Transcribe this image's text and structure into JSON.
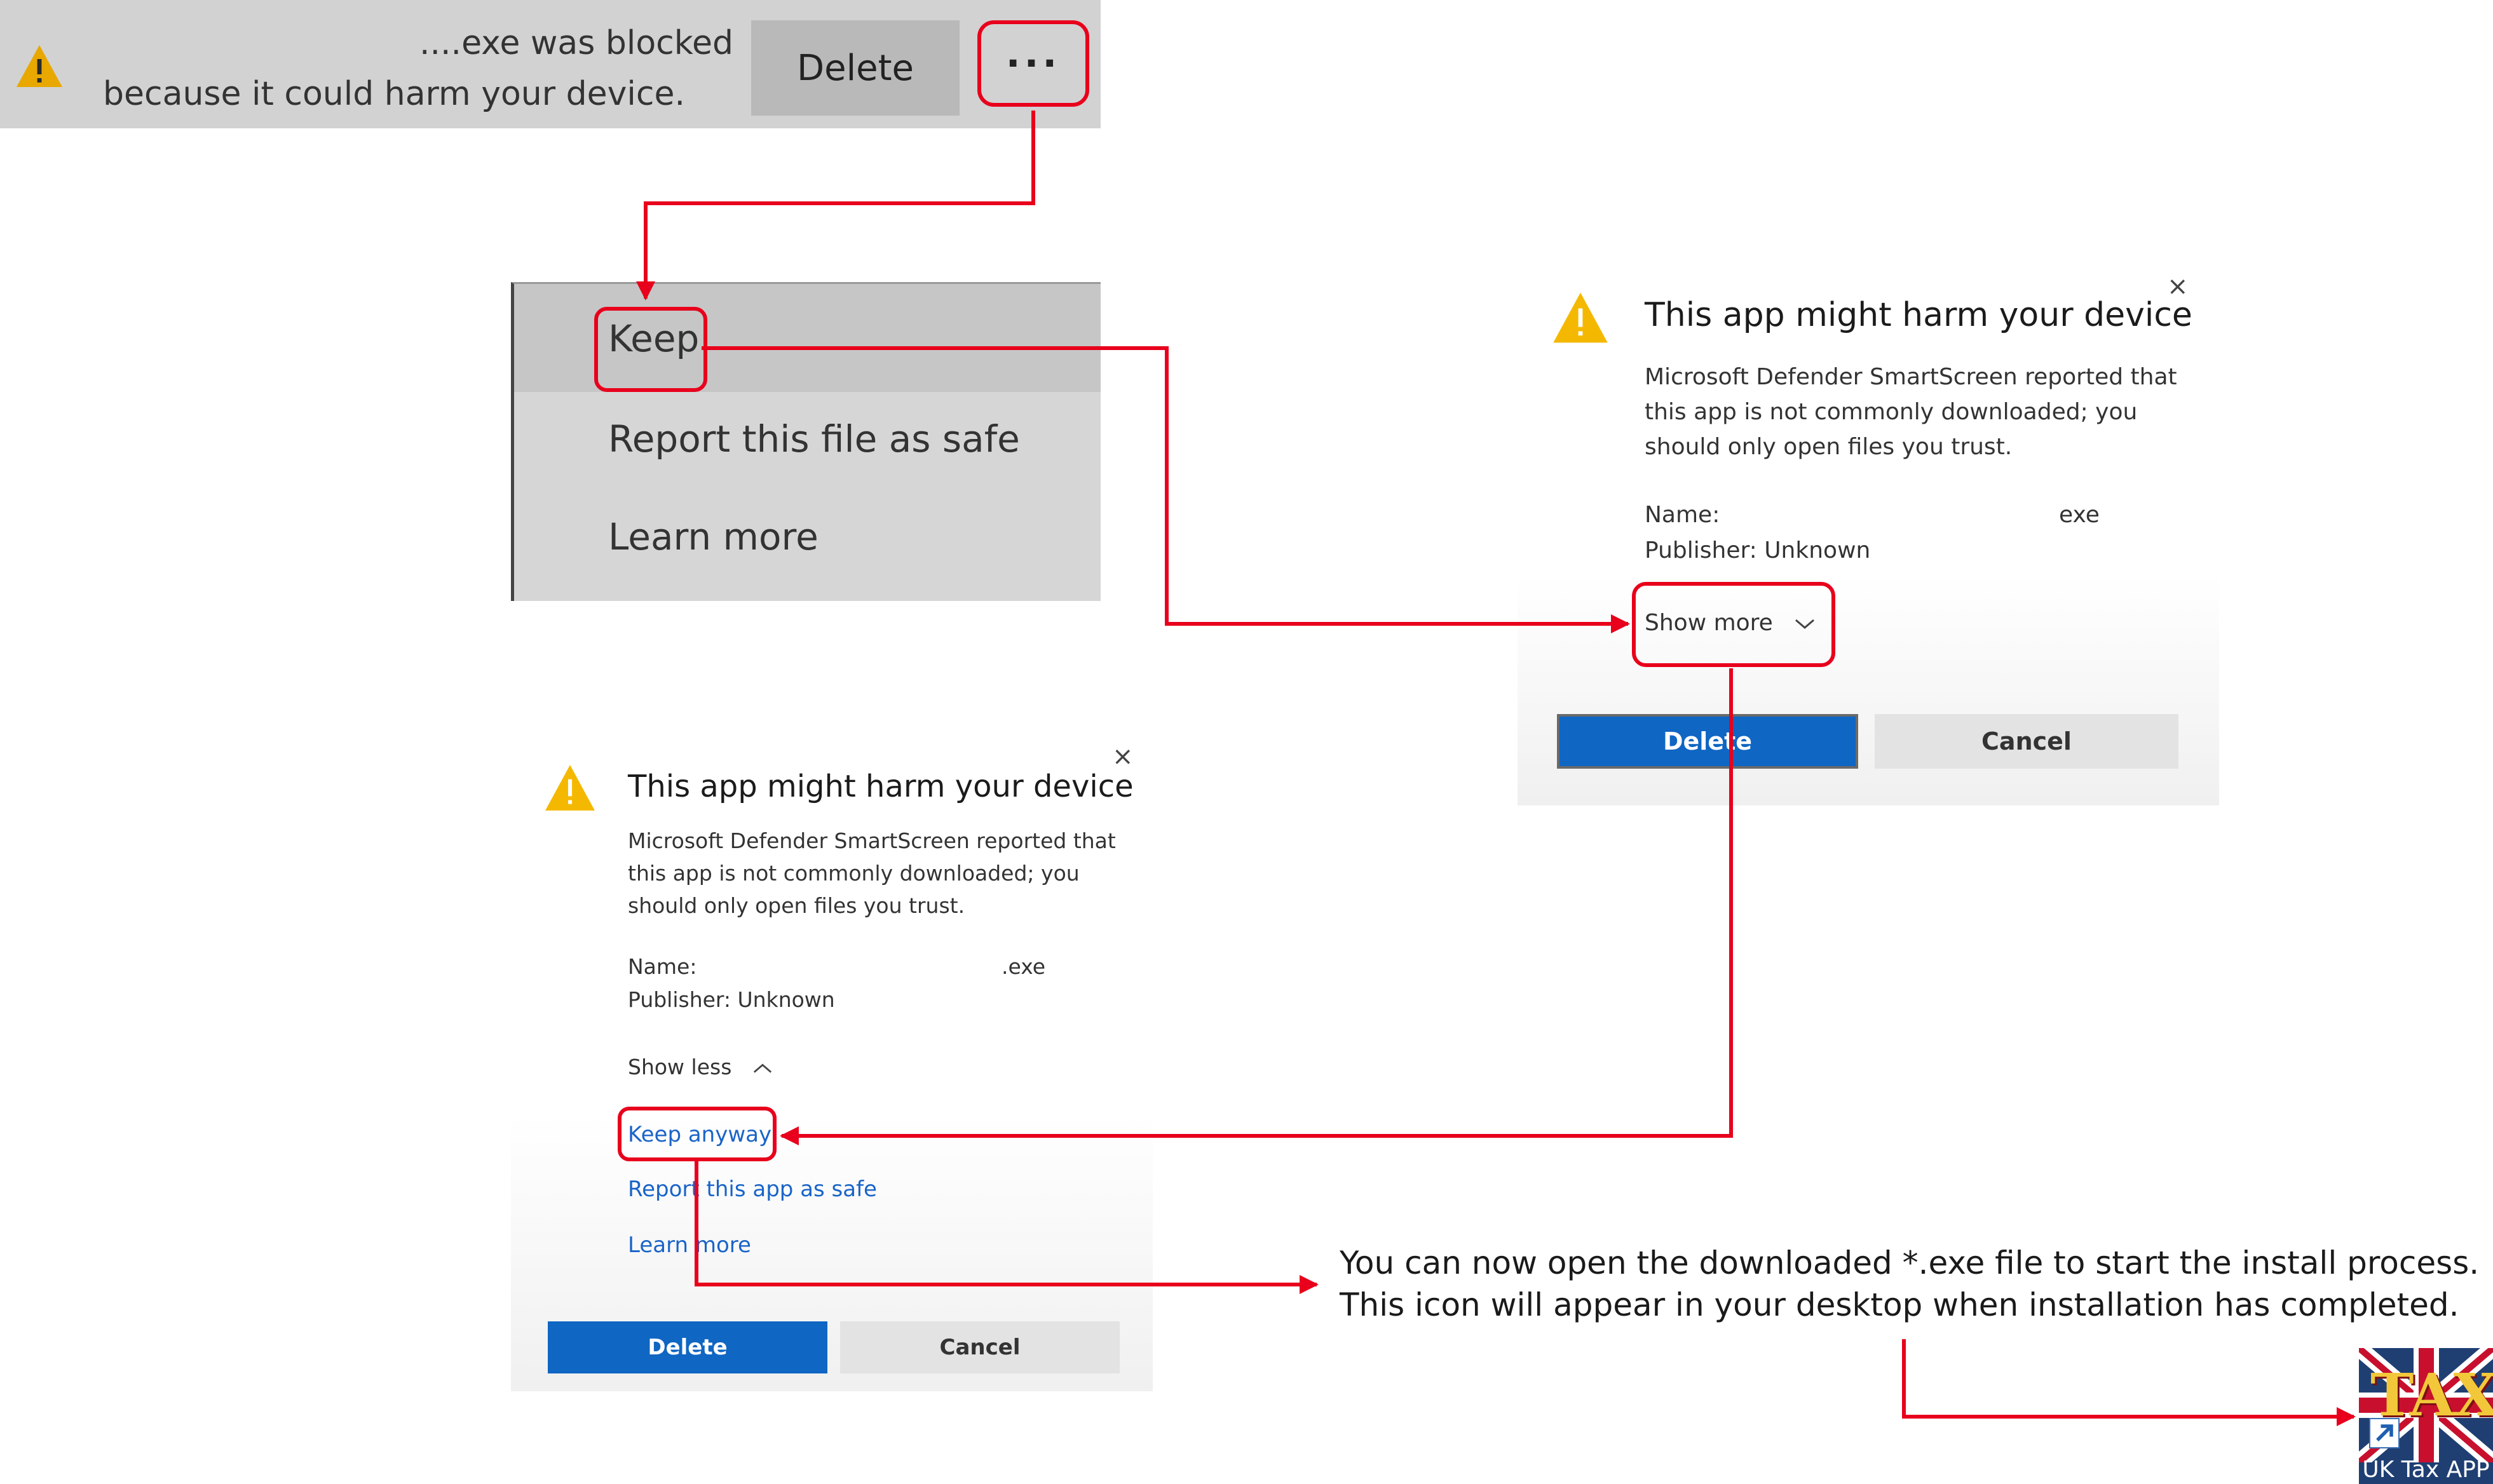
{
  "download_bar": {
    "message_line1": "....exe was blocked",
    "message_line2": "because it could harm your device.",
    "delete_label": "Delete",
    "more_label": "···"
  },
  "context_menu": {
    "items": [
      "Keep",
      "Report this file as safe",
      "Learn more"
    ]
  },
  "dialog_collapsed": {
    "title": "This app might harm your device",
    "body": "Microsoft Defender SmartScreen reported that this app is not commonly downloaded; you should only open files you trust.",
    "name_label": "Name:",
    "name_value": "exe",
    "publisher": "Publisher: Unknown",
    "show_more": "Show more",
    "delete_label": "Delete",
    "cancel_label": "Cancel",
    "close": "×"
  },
  "dialog_expanded": {
    "title": "This app might harm your device",
    "body": "Microsoft Defender SmartScreen reported that this app is not commonly downloaded; you should only open files you trust.",
    "name_label": "Name:",
    "name_value": ".exe",
    "publisher": "Publisher: Unknown",
    "show_less": "Show less",
    "keep_anyway": "Keep anyway",
    "report_safe": "Report this app as safe",
    "learn_more": "Learn more",
    "delete_label": "Delete",
    "cancel_label": "Cancel",
    "close": "×"
  },
  "note": {
    "line1": "You can now open the downloaded *.exe file to start the install process.",
    "line2": "This icon will appear in your desktop when installation has completed."
  },
  "desktop_icon": {
    "art_text": "TAX",
    "label": "UK Tax APP"
  },
  "colors": {
    "annotation_red": "#e8001c",
    "primary_blue": "#0f66c3",
    "warning_yellow": "#f5b800",
    "link_blue": "#1a64c8"
  }
}
